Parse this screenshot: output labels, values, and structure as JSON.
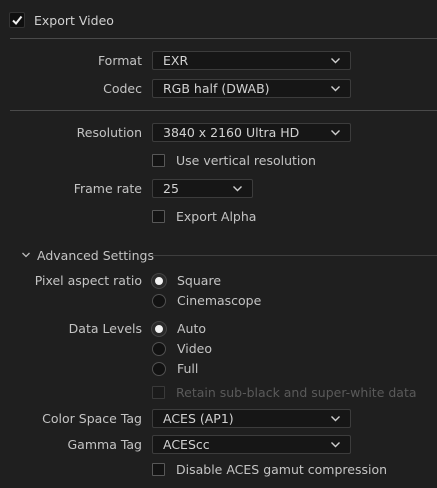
{
  "export_video": {
    "label": "Export Video",
    "checked": true
  },
  "format": {
    "label": "Format",
    "value": "EXR"
  },
  "codec": {
    "label": "Codec",
    "value": "RGB half (DWAB)"
  },
  "resolution": {
    "label": "Resolution",
    "value": "3840 x 2160 Ultra HD"
  },
  "vertical_resolution": {
    "label": "Use vertical resolution",
    "checked": false
  },
  "frame_rate": {
    "label": "Frame rate",
    "value": "25"
  },
  "export_alpha": {
    "label": "Export Alpha",
    "checked": false
  },
  "advanced": {
    "label": "Advanced Settings"
  },
  "pixel_aspect": {
    "label": "Pixel aspect ratio",
    "options": [
      "Square",
      "Cinemascope"
    ],
    "selected": "Square"
  },
  "data_levels": {
    "label": "Data Levels",
    "options": [
      "Auto",
      "Video",
      "Full"
    ],
    "selected": "Auto"
  },
  "retain": {
    "label": "Retain sub-black and super-white data",
    "checked": false,
    "disabled": true
  },
  "color_space": {
    "label": "Color Space Tag",
    "value": "ACES (AP1)"
  },
  "gamma": {
    "label": "Gamma Tag",
    "value": "ACEScc"
  },
  "gamut": {
    "label": "Disable ACES gamut compression",
    "checked": false
  }
}
